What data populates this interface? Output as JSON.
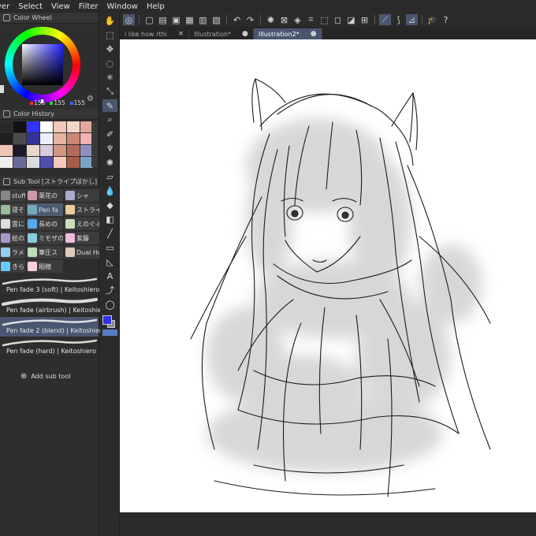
{
  "menu": [
    "yer",
    "Select",
    "View",
    "Filter",
    "Window",
    "Help"
  ],
  "color_wheel": {
    "title": "Color Wheel",
    "r": "155",
    "g": "155",
    "b": "155",
    "current_color": "#3333ee"
  },
  "color_history": {
    "title": "Color History",
    "swatches": [
      "#2a2a2a",
      "#111111",
      "#3333ff",
      "#ffffff",
      "#f0c9b8",
      "#f2d7c9",
      "#e4a79d",
      "#1f1f1f",
      "#4b4b4b",
      "#333399",
      "#eeeeff",
      "#e5b59f",
      "#cc8874",
      "#f0b2b2",
      "#efc6b6",
      "#1a1a2a",
      "#e9d5c9",
      "#d8c9dd",
      "#d39584",
      "#b56b58",
      "#8f8fbf",
      "#eeeeee",
      "#6a6a9a",
      "#dcdcdc",
      "#4f4fb0",
      "#f4cbb8",
      "#a85b46",
      "#7ca3c7"
    ]
  },
  "sub_tool": {
    "title": "Sub Tool [ストライプぼかし]",
    "rows": [
      [
        "stuff th",
        "葉花の",
        "シャ"
      ],
      [
        "寝そべ",
        "Pen fa",
        "ストライ"
      ],
      [
        "雲にじ",
        "長めの",
        "えのぐ-L"
      ],
      [
        "絵の具",
        "ミモザの",
        "紫籐"
      ],
      [
        "ラメ",
        "筆圧ス",
        "Dual Ho"
      ],
      [
        "きらり",
        "稲穂",
        ""
      ]
    ],
    "brushes": [
      "Pen fade 3 (soft) | Keitoshiero",
      "Pen fade (airbrush) | Keitoshiero",
      "Pen fade 2 (blend) | Keitoshiero",
      "Pen fade  (hard) | Keitoshiero"
    ],
    "add_label": "Add sub tool"
  },
  "tabs": [
    {
      "label": "i like how rthi",
      "close": "×"
    },
    {
      "label": "Illustration*",
      "close": "●"
    },
    {
      "label": "Illustration2*",
      "close": "●"
    }
  ]
}
